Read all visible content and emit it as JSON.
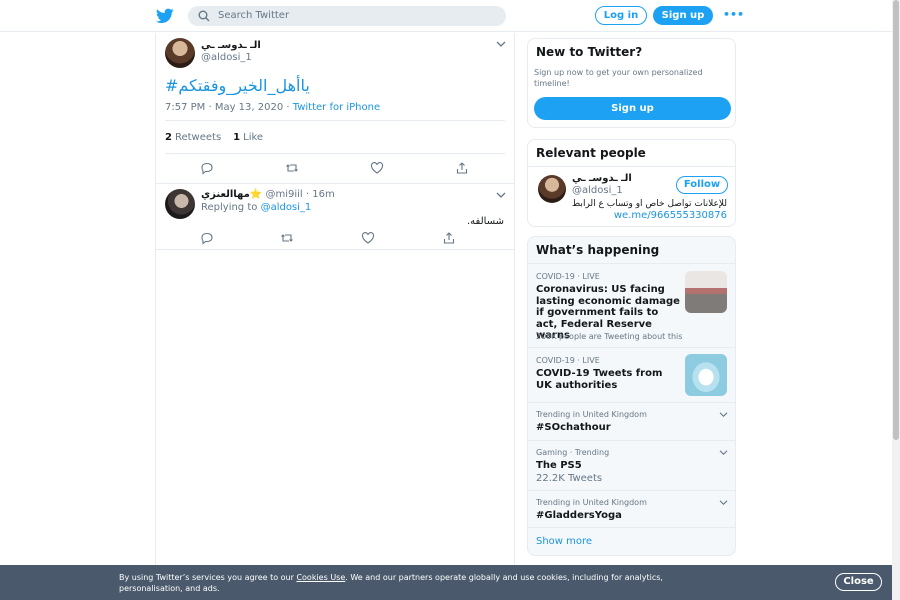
{
  "header": {
    "search_placeholder": "Search Twitter",
    "login_label": "Log in",
    "signup_label": "Sign up",
    "more_label": "•••"
  },
  "tweet": {
    "author_name": "الـ ـدوسـ ـي",
    "author_handle": "@aldosi_1",
    "text": "#ياأهل_الخير_وفقتكم",
    "time": "7:57 PM · May 13, 2020 · ",
    "source": "Twitter for iPhone",
    "retweets_count": "2",
    "retweets_label": "Retweets",
    "likes_count": "1",
    "likes_label": "Like"
  },
  "reply": {
    "author_name": "مهاالعنزي",
    "author_emoji": "⭐",
    "handle_time": " @mi9iil · 16m",
    "replying_prefix": "Replying to ",
    "replying_to": "@aldosi_1",
    "text": "شسالفه."
  },
  "sidebar": {
    "new_title": "New to Twitter?",
    "new_desc": "Sign up now to get your own personalized timeline!",
    "new_signup": "Sign up",
    "relevant_title": "Relevant people",
    "person_name": "الـ ـدوسـ ـي",
    "person_handle": "@aldosi_1",
    "follow_label": "Follow",
    "person_bio": "للإعلانات تواصل خاص او وتساب ع الرابط",
    "person_link": "we.me/966555330876",
    "happening_title": "What’s happening",
    "trends": [
      {
        "context": "COVID-19 · LIVE",
        "title": "Coronavirus: US facing lasting economic damage if government fails to act, Federal Reserve warns",
        "sub": "200K people are Tweeting about this"
      },
      {
        "context": "COVID-19 · LIVE",
        "title": "COVID-19 Tweets from UK authorities"
      },
      {
        "context": "Trending in United Kingdom",
        "title": "#SOchathour"
      },
      {
        "context": "Gaming · Trending",
        "title": "The PS5",
        "count": "22.2K Tweets"
      },
      {
        "context": "Trending in United Kingdom",
        "title": "#GladdersYoga"
      }
    ],
    "show_more": "Show more"
  },
  "cookie": {
    "text_before": "By using Twitter’s services you agree to our ",
    "link": "Cookies Use",
    "text_after": ". We and our partners operate globally and use cookies, including for analytics, personalisation, and ads.",
    "close_label": "Close"
  },
  "colors": {
    "accent": "#1da1f2",
    "link": "#1b95e0",
    "cookie_bg": "#4a5a6c"
  }
}
